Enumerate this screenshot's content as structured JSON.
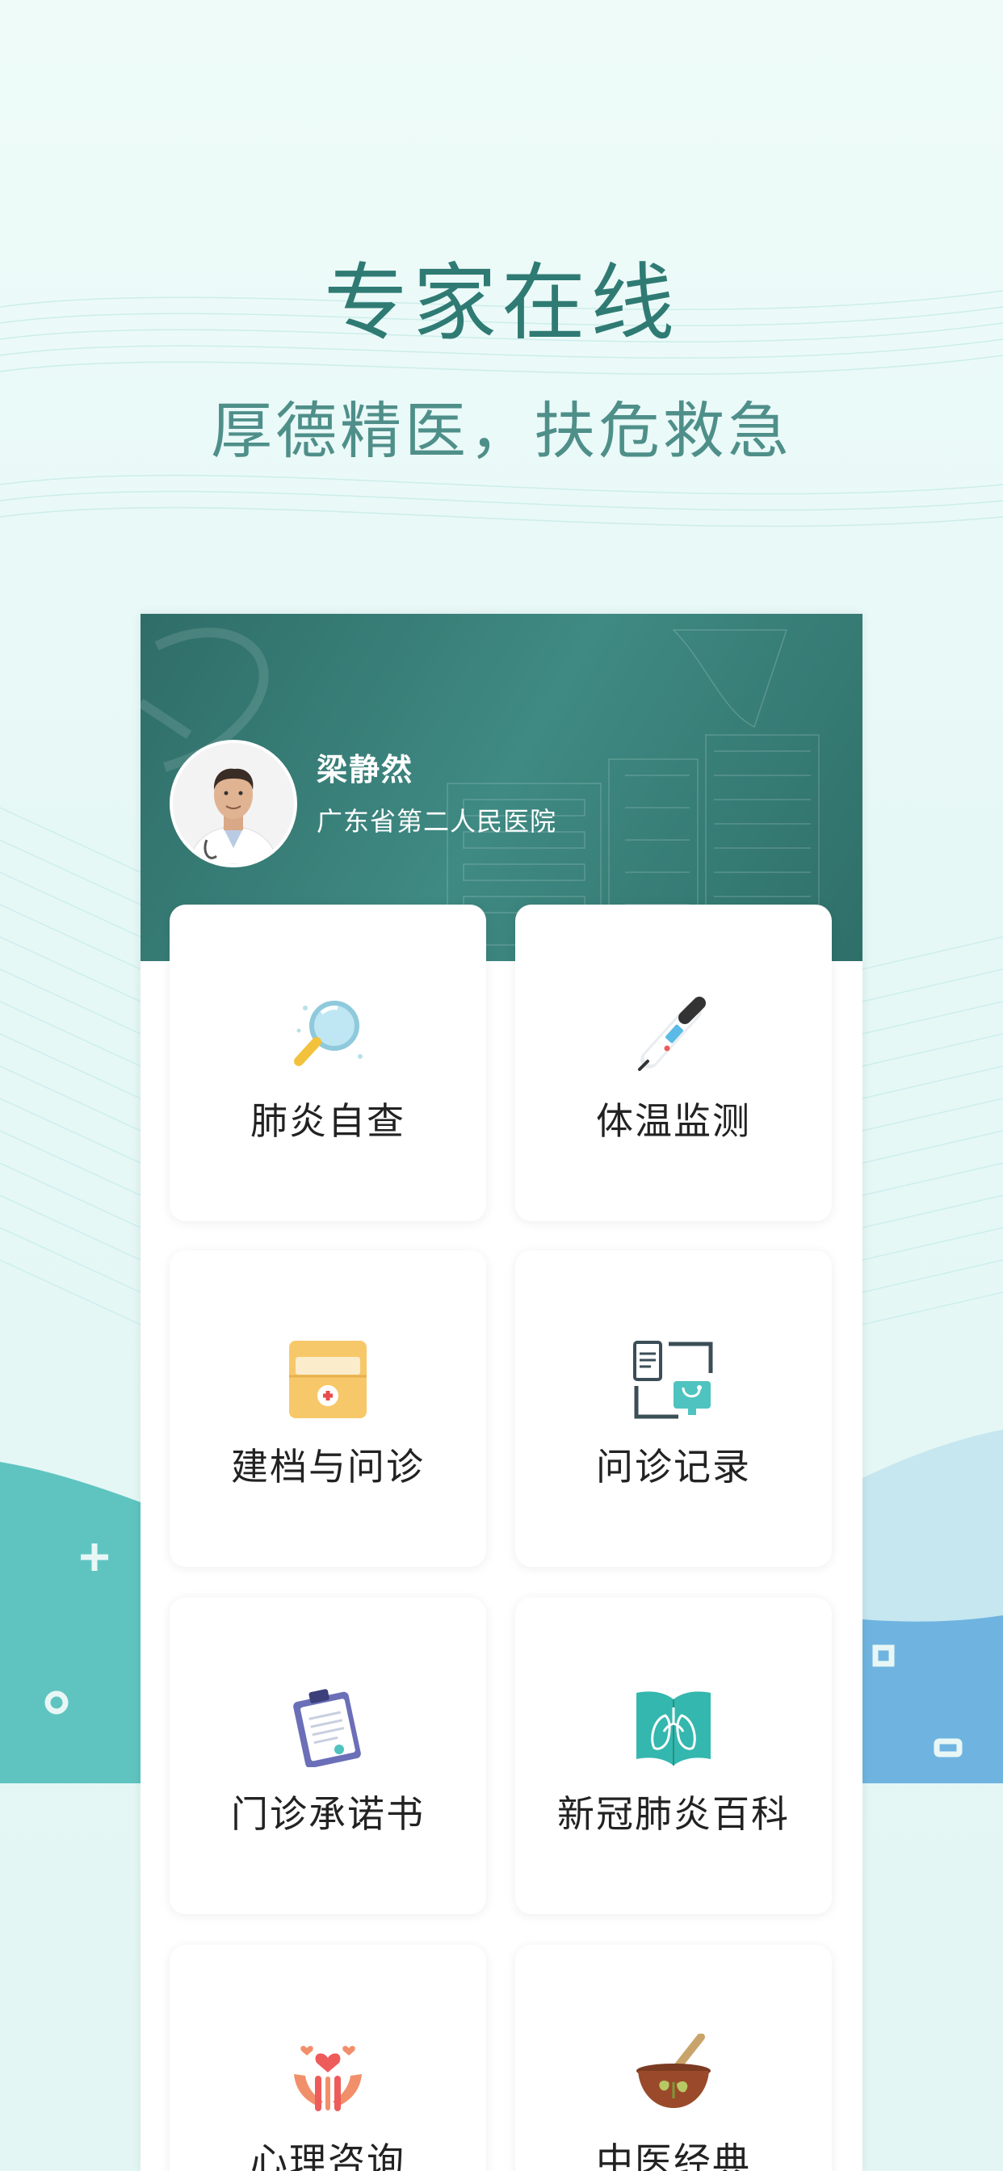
{
  "hero": {
    "title": "专家在线",
    "subtitle": "厚德精医，扶危救急"
  },
  "doctor": {
    "name": "梁静然",
    "hospital": "广东省第二人民医院"
  },
  "tiles": [
    {
      "label": "肺炎自查",
      "icon": "magnifier-icon"
    },
    {
      "label": "体温监测",
      "icon": "thermometer-icon"
    },
    {
      "label": "建档与问诊",
      "icon": "medical-folder-icon"
    },
    {
      "label": "问诊记录",
      "icon": "consult-record-icon"
    },
    {
      "label": "门诊承诺书",
      "icon": "clipboard-icon"
    },
    {
      "label": "新冠肺炎百科",
      "icon": "lung-book-icon"
    },
    {
      "label": "心理咨询",
      "icon": "hands-hearts-icon"
    },
    {
      "label": "中医经典",
      "icon": "mortar-herb-icon"
    }
  ],
  "colors": {
    "theme": "#2f7b74",
    "header": "#3a8079",
    "teal_band": "#5fc4c0",
    "blue_band": "#6fb4e0"
  }
}
